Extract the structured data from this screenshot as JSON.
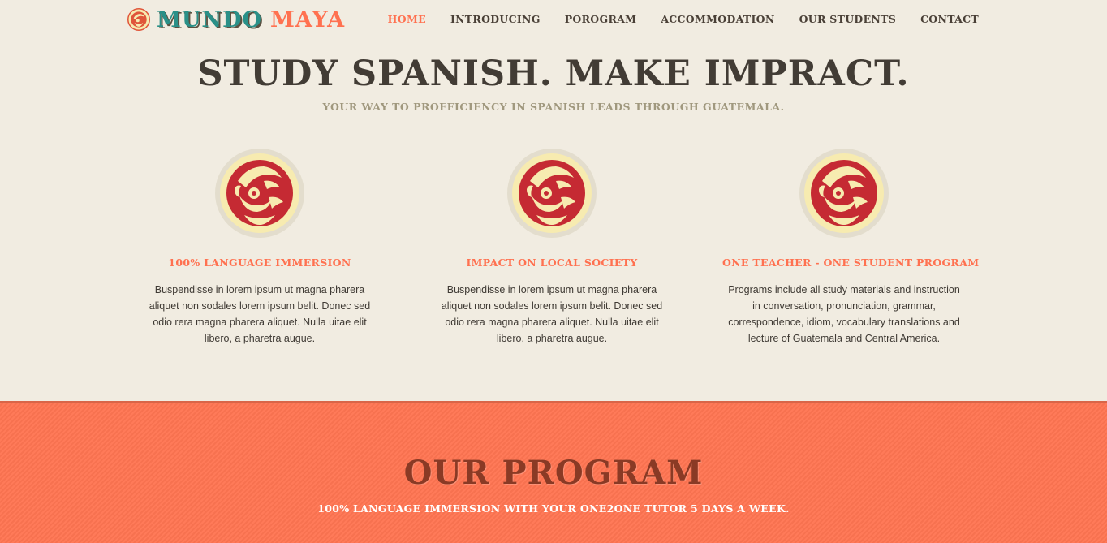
{
  "brand": {
    "word1": "MUNDO",
    "word2": "MAYA",
    "accent": "#ff7150",
    "teal": "#2a9088",
    "background": "#f1ece1"
  },
  "nav": {
    "items": [
      {
        "label": "HOME",
        "active": true
      },
      {
        "label": "INTRODUCING",
        "active": false
      },
      {
        "label": "POROGRAM",
        "active": false
      },
      {
        "label": "ACCOMMODATION",
        "active": false
      },
      {
        "label": "OUR STUDENTS",
        "active": false
      },
      {
        "label": "CONTACT",
        "active": false
      }
    ]
  },
  "hero": {
    "title": "STUDY SPANISH. MAKE IMPRACT.",
    "subtitle": "YOUR WAY TO PROFFICIENCY IN SPANISH LEADS THROUGH GUATEMALA."
  },
  "features": [
    {
      "icon": "maya-emblem-icon",
      "title": "100% LANGUAGE IMMERSION",
      "text": "Buspendisse in lorem ipsum ut magna pharera aliquet non sodales lorem ipsum belit. Donec sed odio rera magna pharera aliquet. Nulla uitae elit libero, a pharetra augue."
    },
    {
      "icon": "maya-emblem-icon",
      "title": "IMPACT ON LOCAL SOCIETY",
      "text": "Buspendisse in lorem ipsum ut magna pharera aliquet non sodales lorem ipsum belit. Donec sed odio rera magna pharera aliquet. Nulla uitae elit libero, a pharetra augue."
    },
    {
      "icon": "maya-emblem-icon",
      "title": "ONE TEACHER - ONE STUDENT PROGRAM",
      "text": "Programs include all study materials and instruction in conversation, pronunciation, grammar, correspondence, idiom, vocabulary translations and lecture of Guatemala and Central America."
    }
  ],
  "program": {
    "title": "OUR PROGRAM",
    "subtitle": "100% LANGUAGE IMMERSION WITH YOUR ONE2ONE TUTOR 5 DAYS A WEEK.",
    "band_color": "#ff7552"
  }
}
